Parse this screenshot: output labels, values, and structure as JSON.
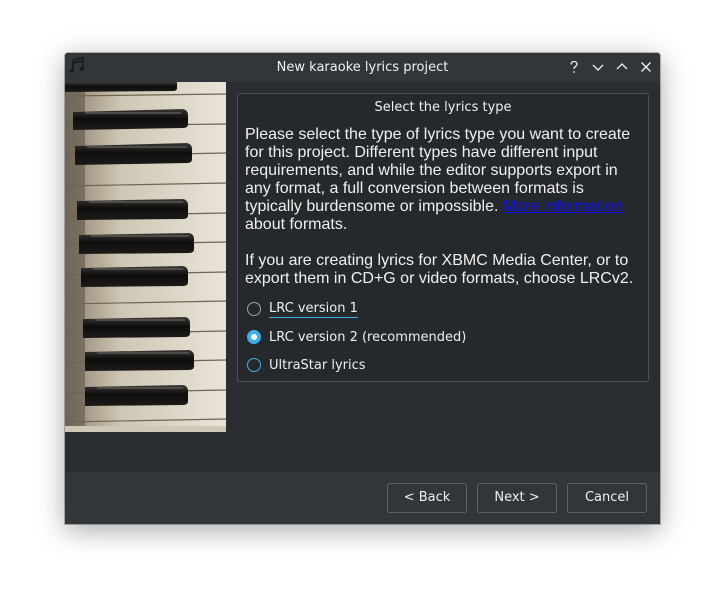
{
  "window": {
    "title": "New karaoke lyrics project"
  },
  "titlebar_icons": [
    "music-notes-icon",
    "help-icon",
    "minimize-icon",
    "maximize-icon",
    "close-icon"
  ],
  "groupbox": {
    "title": "Select the lyrics type",
    "description_part1": "Please select the type of lyrics type you want to create for this project. Different types have different input requirements, and while the editor supports export in any format, a full conversion between formats is typically burdensome or impossible. ",
    "more_info_link": "More information",
    "description_part2": " about formats.",
    "description_second": "If you are creating lyrics for XBMC Media Center, or to export them in CD+G or video formats, choose LRCv2."
  },
  "options": [
    {
      "label": "LRC version 1",
      "checked": false
    },
    {
      "label": "LRC version 2 (recommended)",
      "checked": true
    },
    {
      "label": "UltraStar lyrics",
      "checked": false
    }
  ],
  "buttons": {
    "back": "< Back",
    "next": "Next >",
    "cancel": "Cancel"
  },
  "colors": {
    "accent": "#3daee9",
    "window_bg": "#2a2e32",
    "titlebar_bg": "#31363b",
    "text": "#eff0f1",
    "link": "#1010ee"
  }
}
